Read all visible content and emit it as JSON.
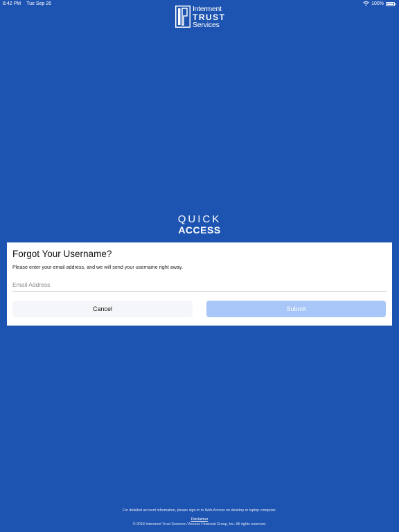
{
  "status_bar": {
    "time": "8:42 PM",
    "date": "Tue Sep 26",
    "battery": "100%"
  },
  "logo": {
    "line1": "Interment",
    "line2": "TRUST",
    "line3": "Services"
  },
  "brand": {
    "line1": "QUICK",
    "line2": "ACCESS"
  },
  "dialog": {
    "title": "Forgot Your Username?",
    "description": "Please enter your email address, and we will send your username right away.",
    "email_placeholder": "Email Address",
    "email_value": "",
    "cancel_label": "Cancel",
    "submit_label": "Submit"
  },
  "footer": {
    "info": "For detailed account information, please sign-in to Web Access on desktop or laptop computer.",
    "disclaimer": "Disclaimer",
    "copyright": "© 2018 Interment Trust Services / Access Financial Group, Inc. All rights reserved."
  },
  "colors": {
    "background": "#1e54b1",
    "submit_disabled": "#a8c6f7",
    "cancel_bg": "#f4f6f9"
  }
}
